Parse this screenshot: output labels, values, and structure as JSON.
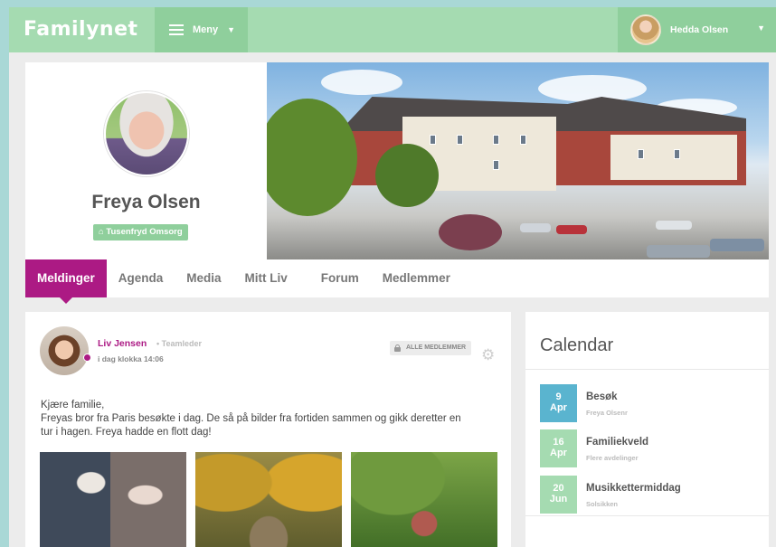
{
  "header": {
    "logo": "Familynet",
    "menu_label": "Meny",
    "user_name": "Hedda Olsen"
  },
  "profile": {
    "name": "Freya Olsen",
    "organization": "Tusenfryd Omsorg"
  },
  "tabs": [
    {
      "label": "Meldinger",
      "active": true
    },
    {
      "label": "Agenda",
      "active": false
    },
    {
      "label": "Media",
      "active": false
    },
    {
      "label": "Mitt Liv",
      "active": false
    },
    {
      "label": "Forum",
      "active": false
    },
    {
      "label": "Medlemmer",
      "active": false
    }
  ],
  "post": {
    "author": "Liv Jensen",
    "role": "• Teamleder",
    "time": "i dag klokka 14:06",
    "audience": "ALLE MEDLEMMER",
    "greeting": "Kjære familie,",
    "body": "Freyas bror fra Paris besøkte i dag. De så på bilder fra fortiden sammen og gikk deretter en tur i hagen. Freya hadde en flott dag!"
  },
  "calendar": {
    "title": "Calendar",
    "events": [
      {
        "day": "9",
        "month": "Apr",
        "title": "Besøk",
        "subtitle": "Freya Olsenr"
      },
      {
        "day": "16",
        "month": "Apr",
        "title": "Familiekveld",
        "subtitle": "Flere avdelinger"
      },
      {
        "day": "20",
        "month": "Jun",
        "title": "Musikkettermiddag",
        "subtitle": "Solsikken"
      }
    ]
  },
  "colors": {
    "brand_green": "#a5dbb1",
    "accent_magenta": "#ac1a84",
    "calendar_blue": "#5ab4cf"
  },
  "icons": {
    "menu": "hamburger-icon",
    "chevron": "chevron-down-icon",
    "home": "home-icon",
    "lock": "lock-icon",
    "settings": "gear-icon"
  }
}
